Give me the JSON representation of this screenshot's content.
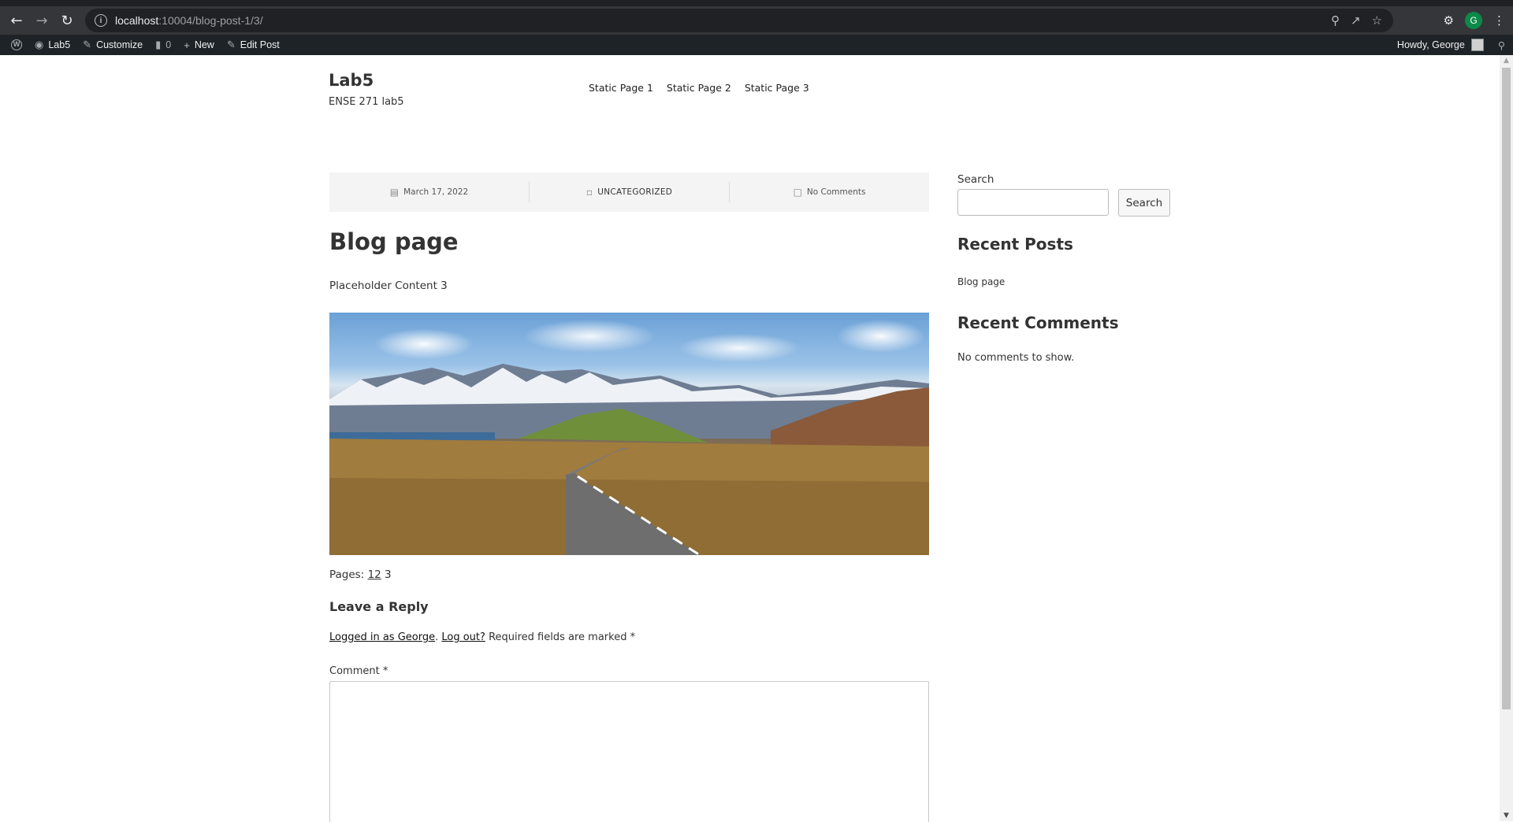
{
  "browser": {
    "url_host": "localhost",
    "url_path": ":10004/blog-post-1/3/",
    "profile_initial": "G"
  },
  "adminbar": {
    "site": "Lab5",
    "customize": "Customize",
    "comments_count": "0",
    "new": "New",
    "edit_post": "Edit Post",
    "howdy": "Howdy, George"
  },
  "site": {
    "title": "Lab5",
    "description": "ENSE 271 lab5"
  },
  "nav": {
    "items": [
      "Static Page 1",
      "Static Page 2",
      "Static Page 3"
    ]
  },
  "post": {
    "date": "March 17, 2022",
    "category": "UNCATEGORIZED",
    "comments": "No Comments",
    "title": "Blog page",
    "content": "Placeholder Content 3",
    "pages_label": "Pages:",
    "page_links": [
      "1",
      "2"
    ],
    "current_page": "3"
  },
  "reply": {
    "title": "Leave a Reply",
    "logged_in": "Logged in as George",
    "logout": "Log out?",
    "required": "Required fields are marked",
    "comment_label": "Comment"
  },
  "sidebar": {
    "search_label": "Search",
    "search_button": "Search",
    "recent_posts_title": "Recent Posts",
    "recent_posts": [
      "Blog page"
    ],
    "recent_comments_title": "Recent Comments",
    "no_comments": "No comments to show."
  }
}
